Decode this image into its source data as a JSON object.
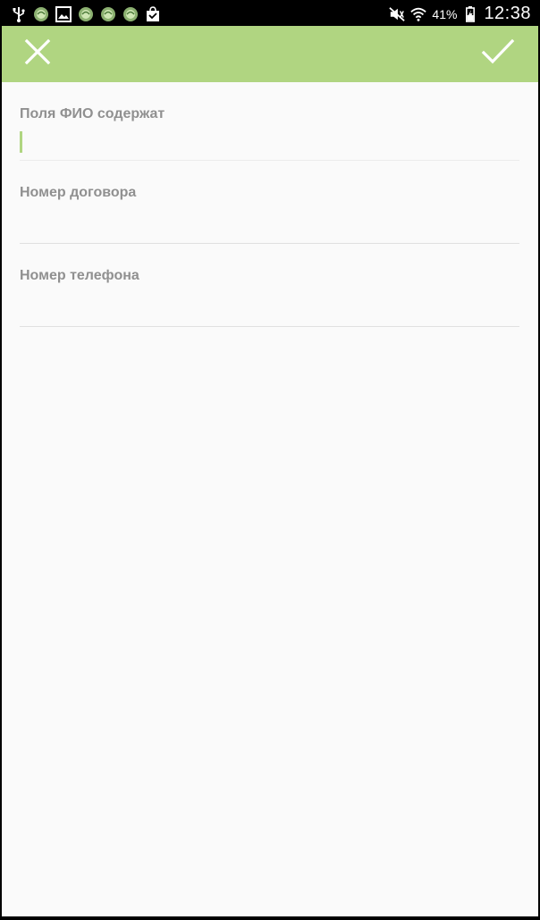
{
  "status_bar": {
    "icons_left": [
      "usb-icon",
      "notification-icon",
      "image-icon",
      "notification-icon",
      "notification-icon",
      "notification-icon",
      "shopping-bag-icon"
    ],
    "icons_right": [
      "mute-icon",
      "wifi-icon",
      "battery-icon"
    ],
    "battery": "41%",
    "time": "12:38"
  },
  "toolbar": {
    "color": "#b0d581",
    "close_icon": "close-icon",
    "confirm_icon": "check-icon"
  },
  "form": {
    "fields": [
      {
        "label": "Поля ФИО содержат",
        "value": ""
      },
      {
        "label": "Номер договора",
        "value": ""
      },
      {
        "label": "Номер телефона",
        "value": ""
      }
    ]
  }
}
